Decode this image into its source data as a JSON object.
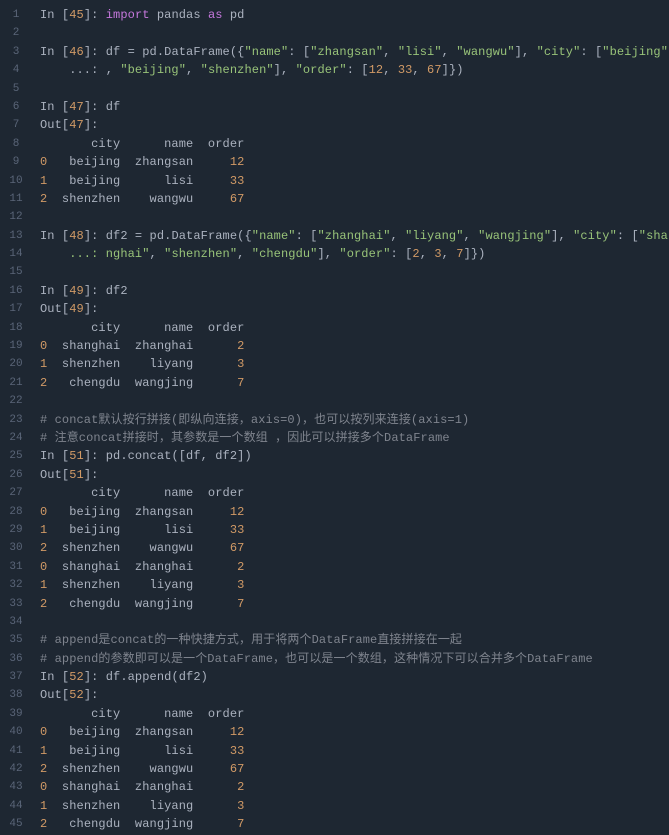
{
  "line_numbers": [
    "1",
    "2",
    "3",
    "4",
    "5",
    "6",
    "7",
    "8",
    "9",
    "10",
    "11",
    "12",
    "13",
    "14",
    "15",
    "16",
    "17",
    "18",
    "19",
    "20",
    "21",
    "22",
    "23",
    "24",
    "25",
    "26",
    "27",
    "28",
    "29",
    "30",
    "31",
    "32",
    "33",
    "34",
    "35",
    "36",
    "37",
    "38",
    "39",
    "40",
    "41",
    "42",
    "43",
    "44",
    "45"
  ],
  "code_lines": {
    "l1": {
      "parts": [
        {
          "t": "In [",
          "c": "plain"
        },
        {
          "t": "45",
          "c": "num"
        },
        {
          "t": "]: ",
          "c": "plain"
        },
        {
          "t": "import",
          "c": "kw"
        },
        {
          "t": " pandas ",
          "c": "plain"
        },
        {
          "t": "as",
          "c": "kw"
        },
        {
          "t": " pd",
          "c": "plain"
        }
      ]
    },
    "l2": {
      "parts": []
    },
    "l3": {
      "parts": [
        {
          "t": "In [",
          "c": "plain"
        },
        {
          "t": "46",
          "c": "num"
        },
        {
          "t": "]: df = pd.DataFrame({",
          "c": "plain"
        },
        {
          "t": "\"name\"",
          "c": "str"
        },
        {
          "t": ": [",
          "c": "plain"
        },
        {
          "t": "\"zhangsan\"",
          "c": "str"
        },
        {
          "t": ", ",
          "c": "plain"
        },
        {
          "t": "\"lisi\"",
          "c": "str"
        },
        {
          "t": ", ",
          "c": "plain"
        },
        {
          "t": "\"wangwu\"",
          "c": "str"
        },
        {
          "t": "], ",
          "c": "plain"
        },
        {
          "t": "\"city\"",
          "c": "str"
        },
        {
          "t": ": [",
          "c": "plain"
        },
        {
          "t": "\"beijing\"",
          "c": "str"
        }
      ]
    },
    "l4": {
      "parts": [
        {
          "t": "    ...: , ",
          "c": "plain"
        },
        {
          "t": "\"beijing\"",
          "c": "str"
        },
        {
          "t": ", ",
          "c": "plain"
        },
        {
          "t": "\"shenzhen\"",
          "c": "str"
        },
        {
          "t": "], ",
          "c": "plain"
        },
        {
          "t": "\"order\"",
          "c": "str"
        },
        {
          "t": ": [",
          "c": "plain"
        },
        {
          "t": "12",
          "c": "num"
        },
        {
          "t": ", ",
          "c": "plain"
        },
        {
          "t": "33",
          "c": "num"
        },
        {
          "t": ", ",
          "c": "plain"
        },
        {
          "t": "67",
          "c": "num"
        },
        {
          "t": "]})",
          "c": "plain"
        }
      ]
    },
    "l5": {
      "parts": []
    },
    "l6": {
      "parts": [
        {
          "t": "In [",
          "c": "plain"
        },
        {
          "t": "47",
          "c": "num"
        },
        {
          "t": "]: df",
          "c": "plain"
        }
      ]
    },
    "l7": {
      "parts": [
        {
          "t": "Out[",
          "c": "plain"
        },
        {
          "t": "47",
          "c": "num"
        },
        {
          "t": "]:",
          "c": "plain"
        }
      ]
    },
    "l8": {
      "parts": [
        {
          "t": "       city      name  order",
          "c": "plain"
        }
      ]
    },
    "l9": {
      "parts": [
        {
          "t": "0",
          "c": "num"
        },
        {
          "t": "   beijing  zhangsan     ",
          "c": "plain"
        },
        {
          "t": "12",
          "c": "num"
        }
      ]
    },
    "l10": {
      "parts": [
        {
          "t": "1",
          "c": "num"
        },
        {
          "t": "   beijing      lisi     ",
          "c": "plain"
        },
        {
          "t": "33",
          "c": "num"
        }
      ]
    },
    "l11": {
      "parts": [
        {
          "t": "2",
          "c": "num"
        },
        {
          "t": "  shenzhen    wangwu     ",
          "c": "plain"
        },
        {
          "t": "67",
          "c": "num"
        }
      ]
    },
    "l12": {
      "parts": []
    },
    "l13": {
      "parts": [
        {
          "t": "In [",
          "c": "plain"
        },
        {
          "t": "48",
          "c": "num"
        },
        {
          "t": "]: df2 = pd.DataFrame({",
          "c": "plain"
        },
        {
          "t": "\"name\"",
          "c": "str"
        },
        {
          "t": ": [",
          "c": "plain"
        },
        {
          "t": "\"zhanghai\"",
          "c": "str"
        },
        {
          "t": ", ",
          "c": "plain"
        },
        {
          "t": "\"liyang\"",
          "c": "str"
        },
        {
          "t": ", ",
          "c": "plain"
        },
        {
          "t": "\"wangjing\"",
          "c": "str"
        },
        {
          "t": "], ",
          "c": "plain"
        },
        {
          "t": "\"city\"",
          "c": "str"
        },
        {
          "t": ": [",
          "c": "plain"
        },
        {
          "t": "\"sha",
          "c": "str"
        }
      ]
    },
    "l14": {
      "parts": [
        {
          "t": "    ...: nghai\"",
          "c": "str"
        },
        {
          "t": ", ",
          "c": "plain"
        },
        {
          "t": "\"shenzhen\"",
          "c": "str"
        },
        {
          "t": ", ",
          "c": "plain"
        },
        {
          "t": "\"chengdu\"",
          "c": "str"
        },
        {
          "t": "], ",
          "c": "plain"
        },
        {
          "t": "\"order\"",
          "c": "str"
        },
        {
          "t": ": [",
          "c": "plain"
        },
        {
          "t": "2",
          "c": "num"
        },
        {
          "t": ", ",
          "c": "plain"
        },
        {
          "t": "3",
          "c": "num"
        },
        {
          "t": ", ",
          "c": "plain"
        },
        {
          "t": "7",
          "c": "num"
        },
        {
          "t": "]})",
          "c": "plain"
        }
      ]
    },
    "l15": {
      "parts": []
    },
    "l16": {
      "parts": [
        {
          "t": "In [",
          "c": "plain"
        },
        {
          "t": "49",
          "c": "num"
        },
        {
          "t": "]: df2",
          "c": "plain"
        }
      ]
    },
    "l17": {
      "parts": [
        {
          "t": "Out[",
          "c": "plain"
        },
        {
          "t": "49",
          "c": "num"
        },
        {
          "t": "]:",
          "c": "plain"
        }
      ]
    },
    "l18": {
      "parts": [
        {
          "t": "       city      name  order",
          "c": "plain"
        }
      ]
    },
    "l19": {
      "parts": [
        {
          "t": "0",
          "c": "num"
        },
        {
          "t": "  shanghai  zhanghai      ",
          "c": "plain"
        },
        {
          "t": "2",
          "c": "num"
        }
      ]
    },
    "l20": {
      "parts": [
        {
          "t": "1",
          "c": "num"
        },
        {
          "t": "  shenzhen    liyang      ",
          "c": "plain"
        },
        {
          "t": "3",
          "c": "num"
        }
      ]
    },
    "l21": {
      "parts": [
        {
          "t": "2",
          "c": "num"
        },
        {
          "t": "   chengdu  wangjing      ",
          "c": "plain"
        },
        {
          "t": "7",
          "c": "num"
        }
      ]
    },
    "l22": {
      "parts": []
    },
    "l23": {
      "parts": [
        {
          "t": "# concat默认按行拼接(即纵向连接，axis=0)，也可以按列来连接(axis=1)",
          "c": "comm"
        }
      ]
    },
    "l24": {
      "parts": [
        {
          "t": "# 注意concat拼接时，其参数是一个数组 ，因此可以拼接多个DataFrame",
          "c": "comm"
        }
      ]
    },
    "l25": {
      "parts": [
        {
          "t": "In [",
          "c": "plain"
        },
        {
          "t": "51",
          "c": "num"
        },
        {
          "t": "]: pd.concat([df, df2])",
          "c": "plain"
        }
      ]
    },
    "l26": {
      "parts": [
        {
          "t": "Out[",
          "c": "plain"
        },
        {
          "t": "51",
          "c": "num"
        },
        {
          "t": "]:",
          "c": "plain"
        }
      ]
    },
    "l27": {
      "parts": [
        {
          "t": "       city      name  order",
          "c": "plain"
        }
      ]
    },
    "l28": {
      "parts": [
        {
          "t": "0",
          "c": "num"
        },
        {
          "t": "   beijing  zhangsan     ",
          "c": "plain"
        },
        {
          "t": "12",
          "c": "num"
        }
      ]
    },
    "l29": {
      "parts": [
        {
          "t": "1",
          "c": "num"
        },
        {
          "t": "   beijing      lisi     ",
          "c": "plain"
        },
        {
          "t": "33",
          "c": "num"
        }
      ]
    },
    "l30": {
      "parts": [
        {
          "t": "2",
          "c": "num"
        },
        {
          "t": "  shenzhen    wangwu     ",
          "c": "plain"
        },
        {
          "t": "67",
          "c": "num"
        }
      ]
    },
    "l31": {
      "parts": [
        {
          "t": "0",
          "c": "num"
        },
        {
          "t": "  shanghai  zhanghai      ",
          "c": "plain"
        },
        {
          "t": "2",
          "c": "num"
        }
      ]
    },
    "l32": {
      "parts": [
        {
          "t": "1",
          "c": "num"
        },
        {
          "t": "  shenzhen    liyang      ",
          "c": "plain"
        },
        {
          "t": "3",
          "c": "num"
        }
      ]
    },
    "l33": {
      "parts": [
        {
          "t": "2",
          "c": "num"
        },
        {
          "t": "   chengdu  wangjing      ",
          "c": "plain"
        },
        {
          "t": "7",
          "c": "num"
        }
      ]
    },
    "l34": {
      "parts": []
    },
    "l35": {
      "parts": [
        {
          "t": "# append是concat的一种快捷方式，用于将两个DataFrame直接拼接在一起",
          "c": "comm"
        }
      ]
    },
    "l36": {
      "parts": [
        {
          "t": "# append的参数即可以是一个DataFrame，也可以是一个数组，这种情况下可以合并多个DataFrame",
          "c": "comm"
        }
      ]
    },
    "l37": {
      "parts": [
        {
          "t": "In [",
          "c": "plain"
        },
        {
          "t": "52",
          "c": "num"
        },
        {
          "t": "]: df.append(df2)",
          "c": "plain"
        }
      ]
    },
    "l38": {
      "parts": [
        {
          "t": "Out[",
          "c": "plain"
        },
        {
          "t": "52",
          "c": "num"
        },
        {
          "t": "]:",
          "c": "plain"
        }
      ]
    },
    "l39": {
      "parts": [
        {
          "t": "       city      name  order",
          "c": "plain"
        }
      ]
    },
    "l40": {
      "parts": [
        {
          "t": "0",
          "c": "num"
        },
        {
          "t": "   beijing  zhangsan     ",
          "c": "plain"
        },
        {
          "t": "12",
          "c": "num"
        }
      ]
    },
    "l41": {
      "parts": [
        {
          "t": "1",
          "c": "num"
        },
        {
          "t": "   beijing      lisi     ",
          "c": "plain"
        },
        {
          "t": "33",
          "c": "num"
        }
      ]
    },
    "l42": {
      "parts": [
        {
          "t": "2",
          "c": "num"
        },
        {
          "t": "  shenzhen    wangwu     ",
          "c": "plain"
        },
        {
          "t": "67",
          "c": "num"
        }
      ]
    },
    "l43": {
      "parts": [
        {
          "t": "0",
          "c": "num"
        },
        {
          "t": "  shanghai  zhanghai      ",
          "c": "plain"
        },
        {
          "t": "2",
          "c": "num"
        }
      ]
    },
    "l44": {
      "parts": [
        {
          "t": "1",
          "c": "num"
        },
        {
          "t": "  shenzhen    liyang      ",
          "c": "plain"
        },
        {
          "t": "3",
          "c": "num"
        }
      ]
    },
    "l45": {
      "parts": [
        {
          "t": "2",
          "c": "num"
        },
        {
          "t": "   chengdu  wangjing      ",
          "c": "plain"
        },
        {
          "t": "7",
          "c": "num"
        }
      ]
    }
  }
}
